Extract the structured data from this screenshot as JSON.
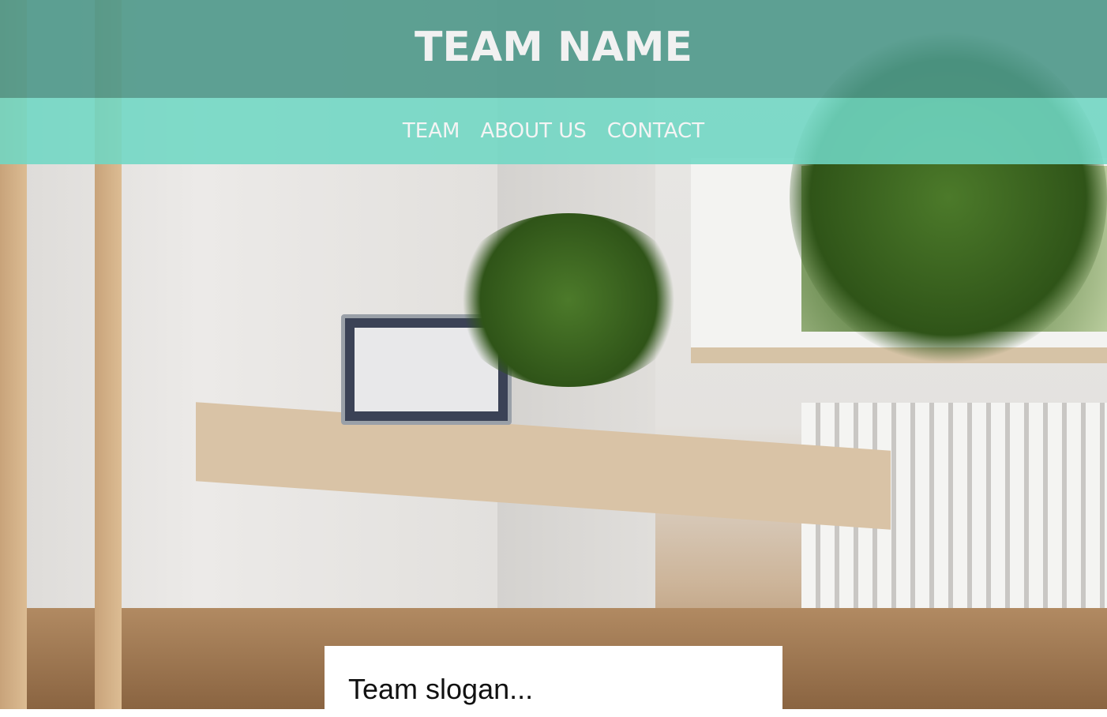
{
  "header": {
    "title": "TEAM NAME"
  },
  "nav": {
    "items": [
      {
        "label": "TEAM"
      },
      {
        "label": "ABOUT US"
      },
      {
        "label": "CONTACT"
      }
    ]
  },
  "hero": {
    "slogan": "Team slogan..."
  },
  "colors": {
    "header_bg": "#4e9889",
    "nav_bg": "#70d7c4",
    "text": "#f1f1f1"
  }
}
